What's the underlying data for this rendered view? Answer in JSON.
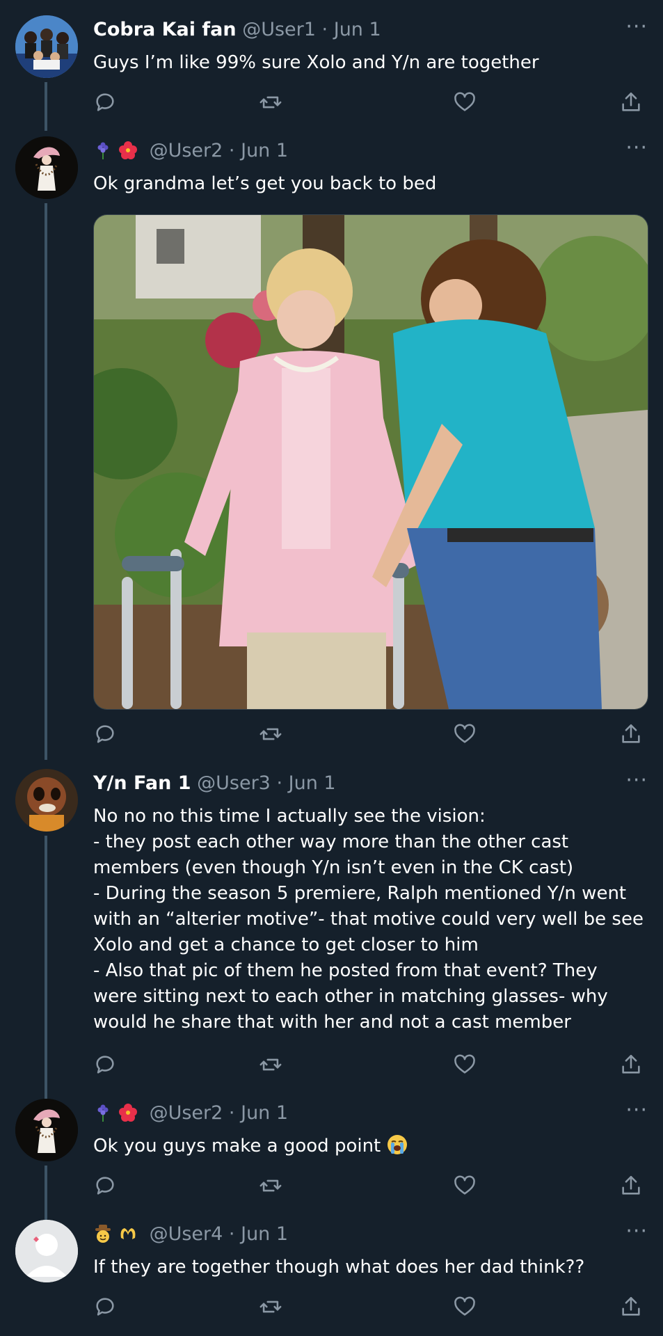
{
  "tweets": [
    {
      "display_name": "Cobra Kai fan",
      "handle": "@User1",
      "sep": "·",
      "date": "Jun 1",
      "text": "Guys I’m like 99% sure Xolo and Y/n are together"
    },
    {
      "display_name": "",
      "handle": "@User2",
      "sep": "·",
      "date": "Jun 1",
      "emojis": [
        "hyacinth-icon",
        "hibiscus-icon"
      ],
      "text": "Ok grandma let’s get you back to bed"
    },
    {
      "display_name": "Y/n Fan 1",
      "handle": "@User3",
      "sep": "·",
      "date": "Jun 1",
      "text": "No no no this time I actually see the vision:\n- they post each other way more than the other cast members (even though Y/n isn’t even in the CK cast)\n- During the season 5 premiere, Ralph mentioned Y/n went with an “alterier motive”- that motive could very well be see Xolo and get a chance to get closer to him\n- Also that pic of them he posted from that event? They were sitting next to each other in matching glasses- why would he share that with her and not a cast member"
    },
    {
      "display_name": "",
      "handle": "@User2",
      "sep": "·",
      "date": "Jun 1",
      "emojis": [
        "hyacinth-icon",
        "hibiscus-icon"
      ],
      "text": "Ok you guys make a good point"
    },
    {
      "display_name": "",
      "handle": "@User4",
      "sep": "·",
      "date": "Jun 1",
      "emojis": [
        "cowboy-face-icon",
        "heart-hands-icon"
      ],
      "text": "If they are together though what does her dad think??"
    }
  ],
  "more_label": "···",
  "colors": {
    "background": "#15202b",
    "secondary_text": "#8b98a5",
    "thread_line": "#3d5466"
  }
}
